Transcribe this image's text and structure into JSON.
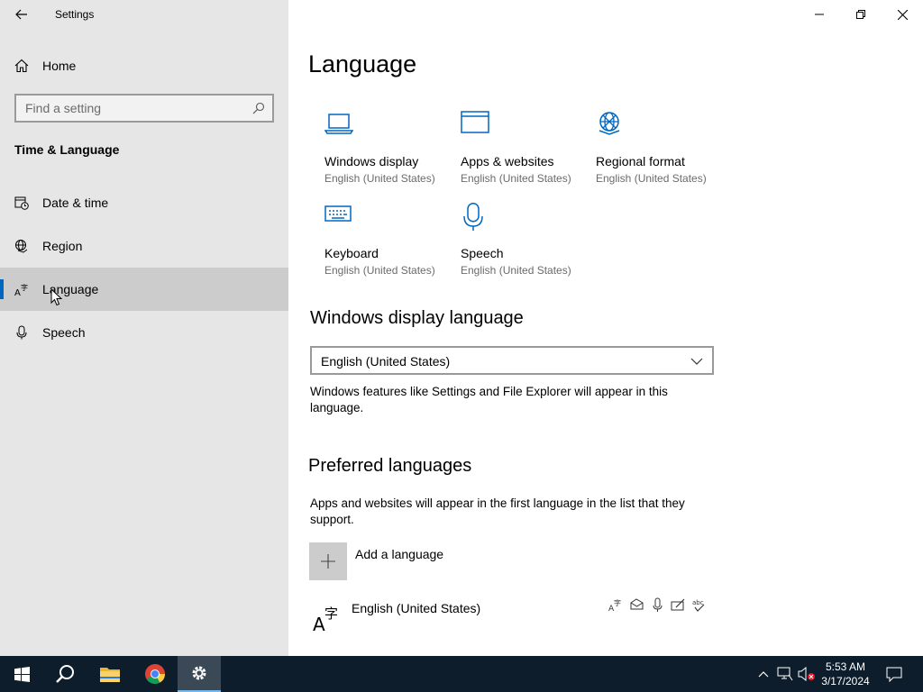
{
  "window": {
    "title": "Settings"
  },
  "sidebar": {
    "home_label": "Home",
    "search_placeholder": "Find a setting",
    "section_title": "Time & Language",
    "items": [
      {
        "label": "Date & time",
        "icon": "clock-calendar-icon"
      },
      {
        "label": "Region",
        "icon": "globe-icon"
      },
      {
        "label": "Language",
        "icon": "language-icon",
        "selected": true
      },
      {
        "label": "Speech",
        "icon": "microphone-icon"
      }
    ]
  },
  "main": {
    "title": "Language",
    "tiles": [
      {
        "name": "Windows display",
        "sub": "English (United States)",
        "icon": "laptop-icon"
      },
      {
        "name": "Apps & websites",
        "sub": "English (United States)",
        "icon": "browser-window-icon"
      },
      {
        "name": "Regional format",
        "sub": "English (United States)",
        "icon": "globe-format-icon"
      },
      {
        "name": "Keyboard",
        "sub": "English (United States)",
        "icon": "keyboard-icon"
      },
      {
        "name": "Speech",
        "sub": "English (United States)",
        "icon": "microphone-icon"
      }
    ],
    "display_language": {
      "heading": "Windows display language",
      "selected": "English (United States)",
      "description": "Windows features like Settings and File Explorer will appear in this language."
    },
    "preferred": {
      "heading": "Preferred languages",
      "description": "Apps and websites will appear in the first language in the list that they support.",
      "add_label": "Add a language",
      "languages": [
        {
          "label": "English (United States)"
        }
      ]
    }
  },
  "taskbar": {
    "time": "5:53 AM",
    "date": "3/17/2024"
  },
  "colors": {
    "accent": "#0067c0",
    "sidebar_bg": "#e6e6e6",
    "selected_bg": "#cccccc",
    "taskbar_bg": "#0d1d2c"
  }
}
